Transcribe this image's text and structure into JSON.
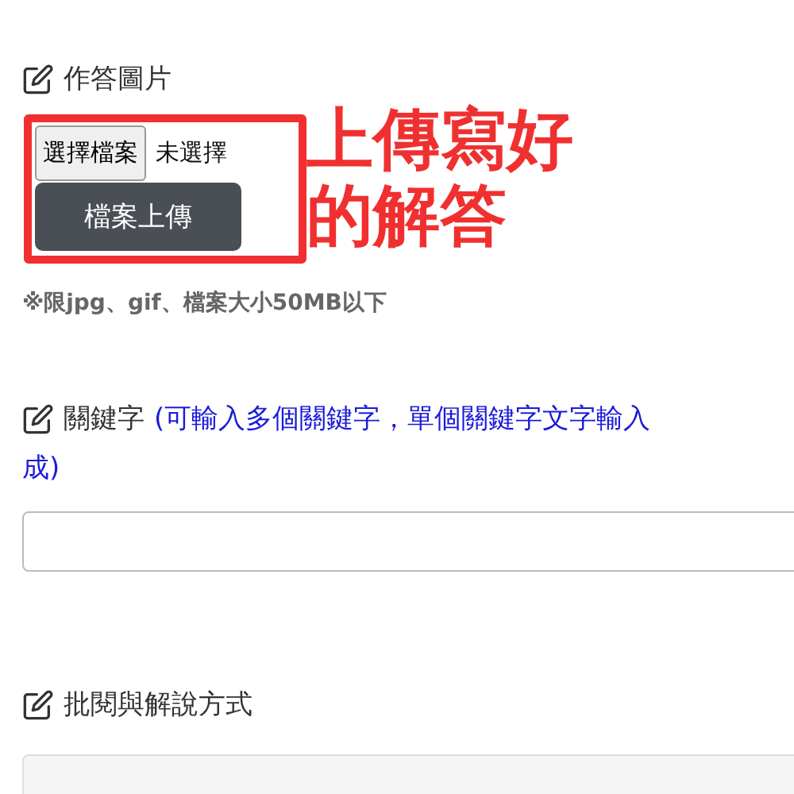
{
  "answer_image": {
    "label": "作答圖片",
    "choose_button": "選擇檔案",
    "file_status": "未選擇",
    "upload_button": "檔案上傳",
    "note": "※限jpg、gif、檔案大小50MB以下"
  },
  "annotation": {
    "lines": [
      "上傳寫好",
      "的解答"
    ]
  },
  "keywords": {
    "label": "關鍵字",
    "hint_line_1": "(可輸入多個關鍵字，單個關鍵字文字輸入",
    "hint_line_2": "成)"
  },
  "review": {
    "label": "批閱與解說方式"
  }
}
